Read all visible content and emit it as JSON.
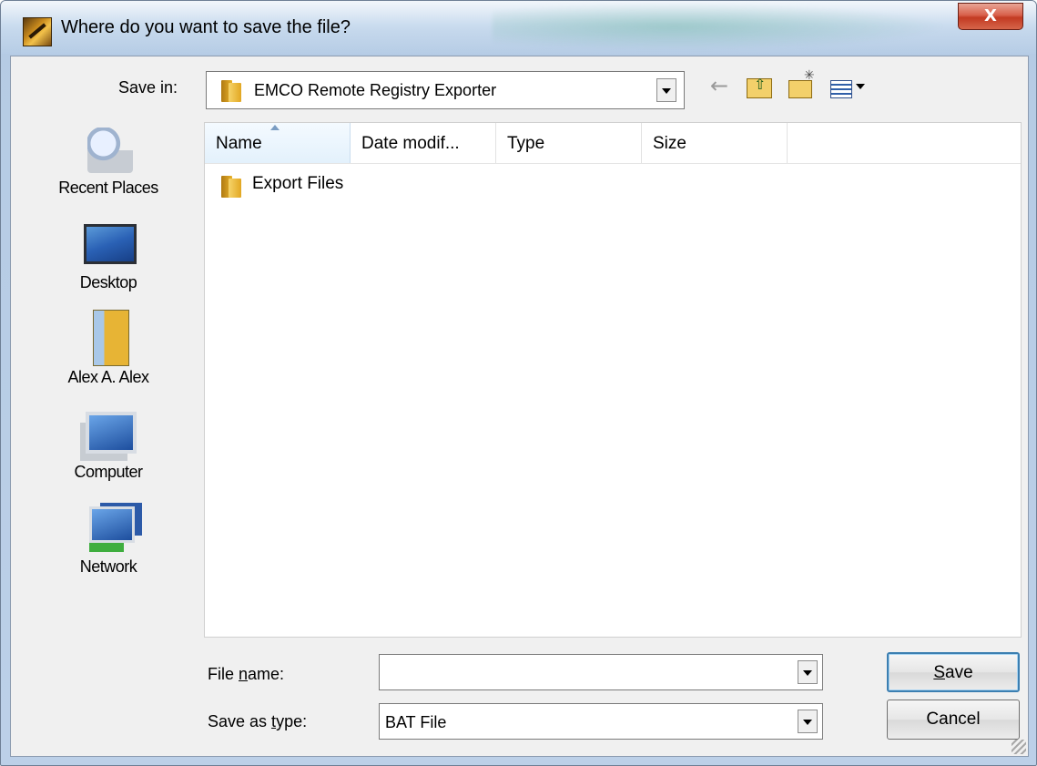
{
  "window": {
    "title": "Where do you want to save the file?",
    "close_label": "X"
  },
  "savein": {
    "label": "Save in:",
    "value": "EMCO Remote Registry Exporter"
  },
  "places": [
    {
      "label": "Recent Places",
      "icon": "recent-places-icon"
    },
    {
      "label": "Desktop",
      "icon": "desktop-icon"
    },
    {
      "label": "Alex A. Alex",
      "icon": "user-folder-icon"
    },
    {
      "label": "Computer",
      "icon": "computer-icon"
    },
    {
      "label": "Network",
      "icon": "network-icon"
    }
  ],
  "columns": [
    "Name",
    "Date modif...",
    "Type",
    "Size"
  ],
  "files": [
    {
      "name": "Export Files",
      "icon": "folder-icon"
    }
  ],
  "filename": {
    "label_prefix": "File ",
    "label_accel": "n",
    "label_suffix": "ame:",
    "value": ""
  },
  "filetype": {
    "label_prefix": "Save as ",
    "label_accel": "t",
    "label_suffix": "ype:",
    "value": "BAT File"
  },
  "buttons": {
    "save_accel": "S",
    "save_rest": "ave",
    "cancel": "Cancel"
  }
}
